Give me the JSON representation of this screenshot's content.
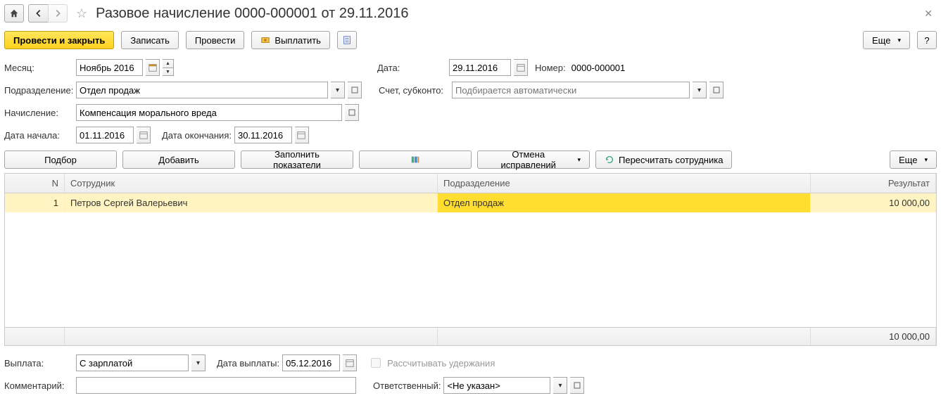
{
  "header": {
    "title": "Разовое начисление 0000-000001 от 29.11.2016"
  },
  "commandBar": {
    "postClose": "Провести и закрыть",
    "write": "Записать",
    "post": "Провести",
    "pay": "Выплатить",
    "more": "Еще",
    "help": "?"
  },
  "form": {
    "monthLabel": "Месяц:",
    "monthValue": "Ноябрь 2016",
    "dateLabel": "Дата:",
    "dateValue": "29.11.2016",
    "numberLabel": "Номер:",
    "numberValue": "0000-000001",
    "departmentLabel": "Подразделение:",
    "departmentValue": "Отдел продаж",
    "accountLabel": "Счет, субконто:",
    "accountPlaceholder": "Подбирается автоматически",
    "accrualLabel": "Начисление:",
    "accrualValue": "Компенсация морального вреда",
    "startLabel": "Дата начала:",
    "startValue": "01.11.2016",
    "endLabel": "Дата окончания:",
    "endValue": "30.11.2016"
  },
  "tableCmd": {
    "selection": "Подбор",
    "add": "Добавить",
    "fill": "Заполнить показатели",
    "cancelFix": "Отмена исправлений",
    "recalc": "Пересчитать сотрудника",
    "more": "Еще"
  },
  "grid": {
    "headers": {
      "n": "N",
      "employee": "Сотрудник",
      "department": "Подразделение",
      "result": "Результат"
    },
    "rows": [
      {
        "n": "1",
        "employee": "Петров Сергей Валерьевич",
        "department": "Отдел продаж",
        "result": "10 000,00"
      }
    ],
    "footer": {
      "total": "10 000,00"
    }
  },
  "bottom": {
    "paymentLabel": "Выплата:",
    "paymentValue": "С зарплатой",
    "payDateLabel": "Дата выплаты:",
    "payDateValue": "05.12.2016",
    "calcHoldLabel": "Рассчитывать удержания",
    "commentLabel": "Комментарий:",
    "commentValue": "",
    "responsibleLabel": "Ответственный:",
    "responsibleValue": "<Не указан>"
  }
}
